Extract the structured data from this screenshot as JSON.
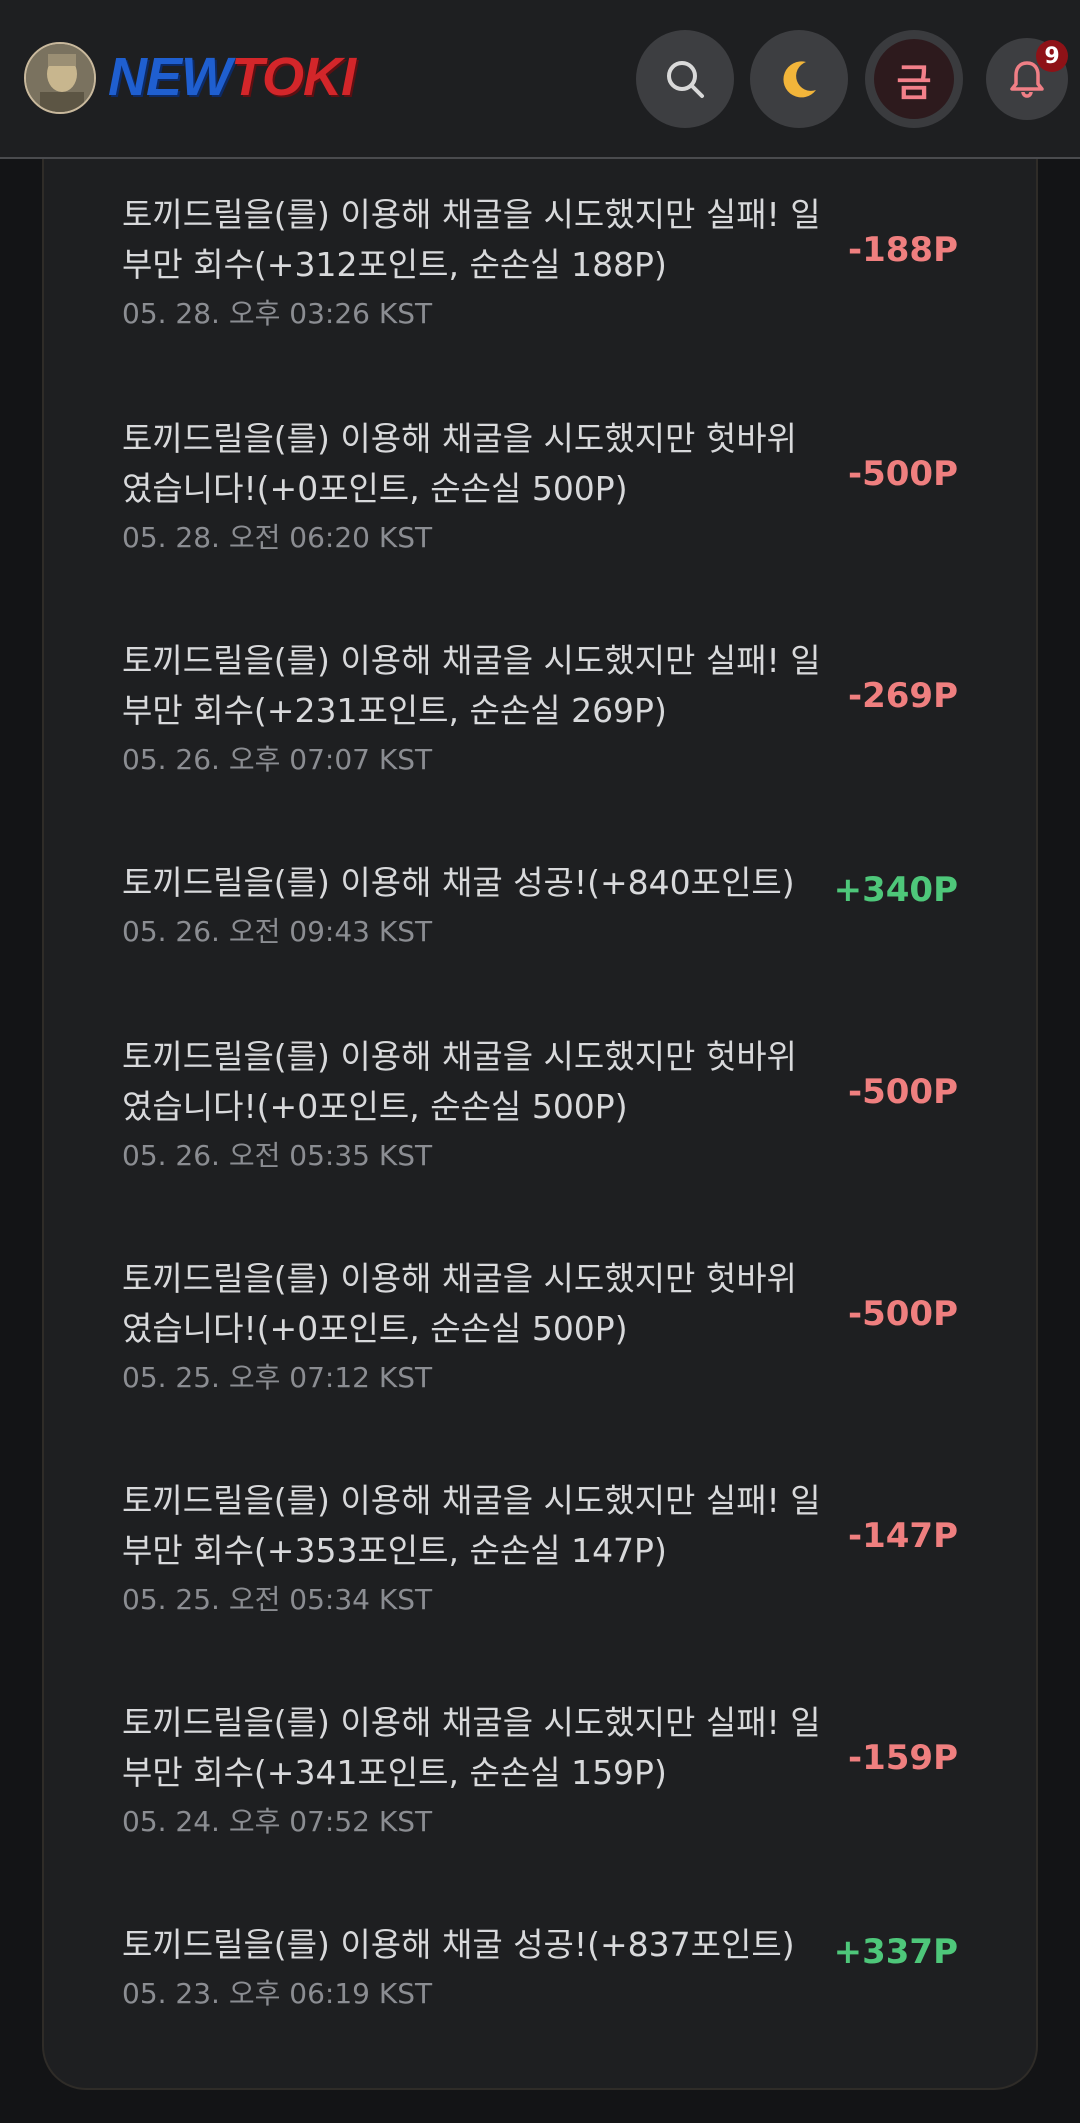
{
  "header": {
    "logo_new": "NEW",
    "logo_toki": "TOKI",
    "gold_label": "금",
    "notification_count": "9"
  },
  "colors": {
    "negative": "#ef7f7f",
    "positive": "#4ec77a",
    "background": "#1e1f21"
  },
  "items": [
    {
      "text": "토끼드릴을(를) 이용해 채굴을 시도했지만 실패! 일부만 회수(+312포인트, 순손실 188P)",
      "date": "05. 28. 오후 03:26 KST",
      "amount": "-188P",
      "type": "negative"
    },
    {
      "text": "토끼드릴을(를) 이용해 채굴을 시도했지만 헛바위였습니다!(+0포인트, 순손실 500P)",
      "date": "05. 28. 오전 06:20 KST",
      "amount": "-500P",
      "type": "negative"
    },
    {
      "text": "토끼드릴을(를) 이용해 채굴을 시도했지만 실패! 일부만 회수(+231포인트, 순손실 269P)",
      "date": "05. 26. 오후 07:07 KST",
      "amount": "-269P",
      "type": "negative"
    },
    {
      "text": "토끼드릴을(를) 이용해 채굴 성공!(+840포인트)",
      "date": "05. 26. 오전 09:43 KST",
      "amount": "+340P",
      "type": "positive"
    },
    {
      "text": "토끼드릴을(를) 이용해 채굴을 시도했지만 헛바위였습니다!(+0포인트, 순손실 500P)",
      "date": "05. 26. 오전 05:35 KST",
      "amount": "-500P",
      "type": "negative"
    },
    {
      "text": "토끼드릴을(를) 이용해 채굴을 시도했지만 헛바위였습니다!(+0포인트, 순손실 500P)",
      "date": "05. 25. 오후 07:12 KST",
      "amount": "-500P",
      "type": "negative"
    },
    {
      "text": "토끼드릴을(를) 이용해 채굴을 시도했지만 실패! 일부만 회수(+353포인트, 순손실 147P)",
      "date": "05. 25. 오전 05:34 KST",
      "amount": "-147P",
      "type": "negative"
    },
    {
      "text": "토끼드릴을(를) 이용해 채굴을 시도했지만 실패! 일부만 회수(+341포인트, 순손실 159P)",
      "date": "05. 24. 오후 07:52 KST",
      "amount": "-159P",
      "type": "negative"
    },
    {
      "text": "토끼드릴을(를) 이용해 채굴 성공!(+837포인트)",
      "date": "05. 23. 오후 06:19 KST",
      "amount": "+337P",
      "type": "positive"
    }
  ]
}
